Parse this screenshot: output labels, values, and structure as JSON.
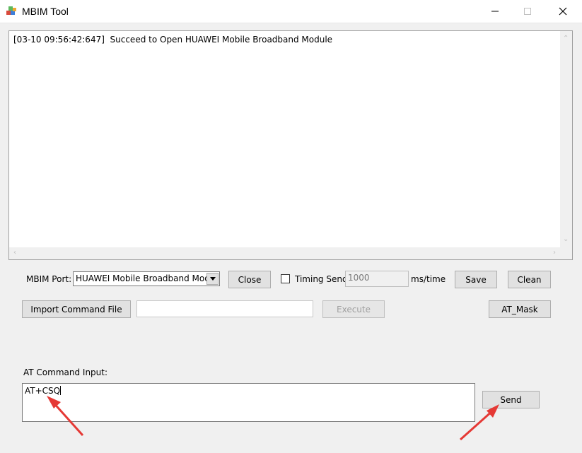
{
  "window": {
    "title": "MBIM Tool",
    "icon": "app-blocks-icon"
  },
  "log": {
    "lines": [
      "[03-10 09:56:42:647]  Succeed to Open HUAWEI Mobile Broadband Module"
    ]
  },
  "controls": {
    "port_label": "MBIM Port:",
    "port_value": "HUAWEI Mobile Broadband Module",
    "close_label": "Close",
    "timing_send_label": "Timing Send",
    "timing_send_checked": false,
    "interval_value": "1000",
    "interval_unit": "ms/time",
    "save_label": "Save",
    "clean_label": "Clean",
    "import_label": "Import Command File",
    "import_path_value": "",
    "execute_label": "Execute",
    "at_mask_label": "AT_Mask"
  },
  "at_command": {
    "label": "AT Command Input:",
    "value": "AT+CSQ",
    "send_label": "Send"
  },
  "colors": {
    "annotation_arrow": "#e53935",
    "window_bg": "#f0f0f0",
    "button_bg": "#e1e1e1"
  }
}
